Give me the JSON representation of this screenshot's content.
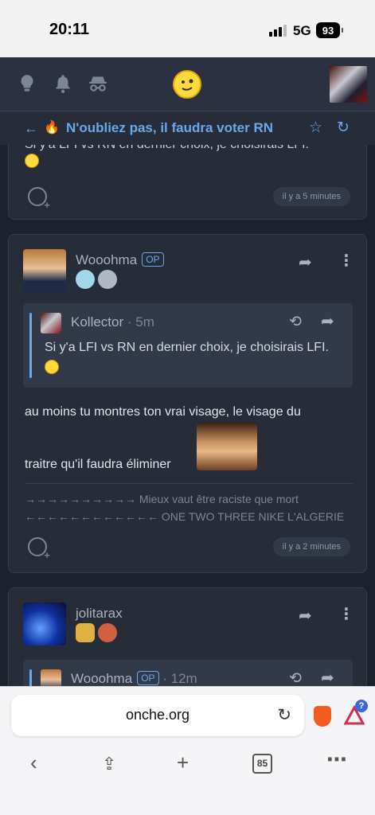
{
  "status_bar": {
    "time": "20:11",
    "network": "5G",
    "battery": "93"
  },
  "app_bar": {
    "icons": [
      "lightbulb-icon",
      "bell-icon",
      "incognito-icon",
      "smiley-logo",
      "user-avatar"
    ]
  },
  "topic": {
    "title": "N'oubliez pas, il faudra voter RN"
  },
  "posts": [
    {
      "partial_text": "Si y'a LFI vs RN en dernier choix, je choisirais LFI.",
      "time": "il y a 5 minutes"
    },
    {
      "author": "Wooohma",
      "op_label": "OP",
      "quote": {
        "author": "Kollector",
        "age": "5m",
        "text": "Si y'a LFI vs RN en dernier choix, je choisirais LFI."
      },
      "line1": "au moins tu montres ton vrai visage, le visage du",
      "line2": "traitre qu'il faudra éliminer",
      "signature1": "→→→→→→→→→→ Mieux vaut être raciste que mort",
      "signature2": "←←←←←←←←←←←← ONE TWO THREE NIKE L'ALGERIE",
      "time": "il y a 2 minutes"
    },
    {
      "author": "jolitarax",
      "quote": {
        "author": "Wooohma",
        "op_label": "OP",
        "age": "12m"
      }
    }
  ],
  "browser": {
    "url": "onche.org",
    "tab_count": "85",
    "badge": "?"
  }
}
